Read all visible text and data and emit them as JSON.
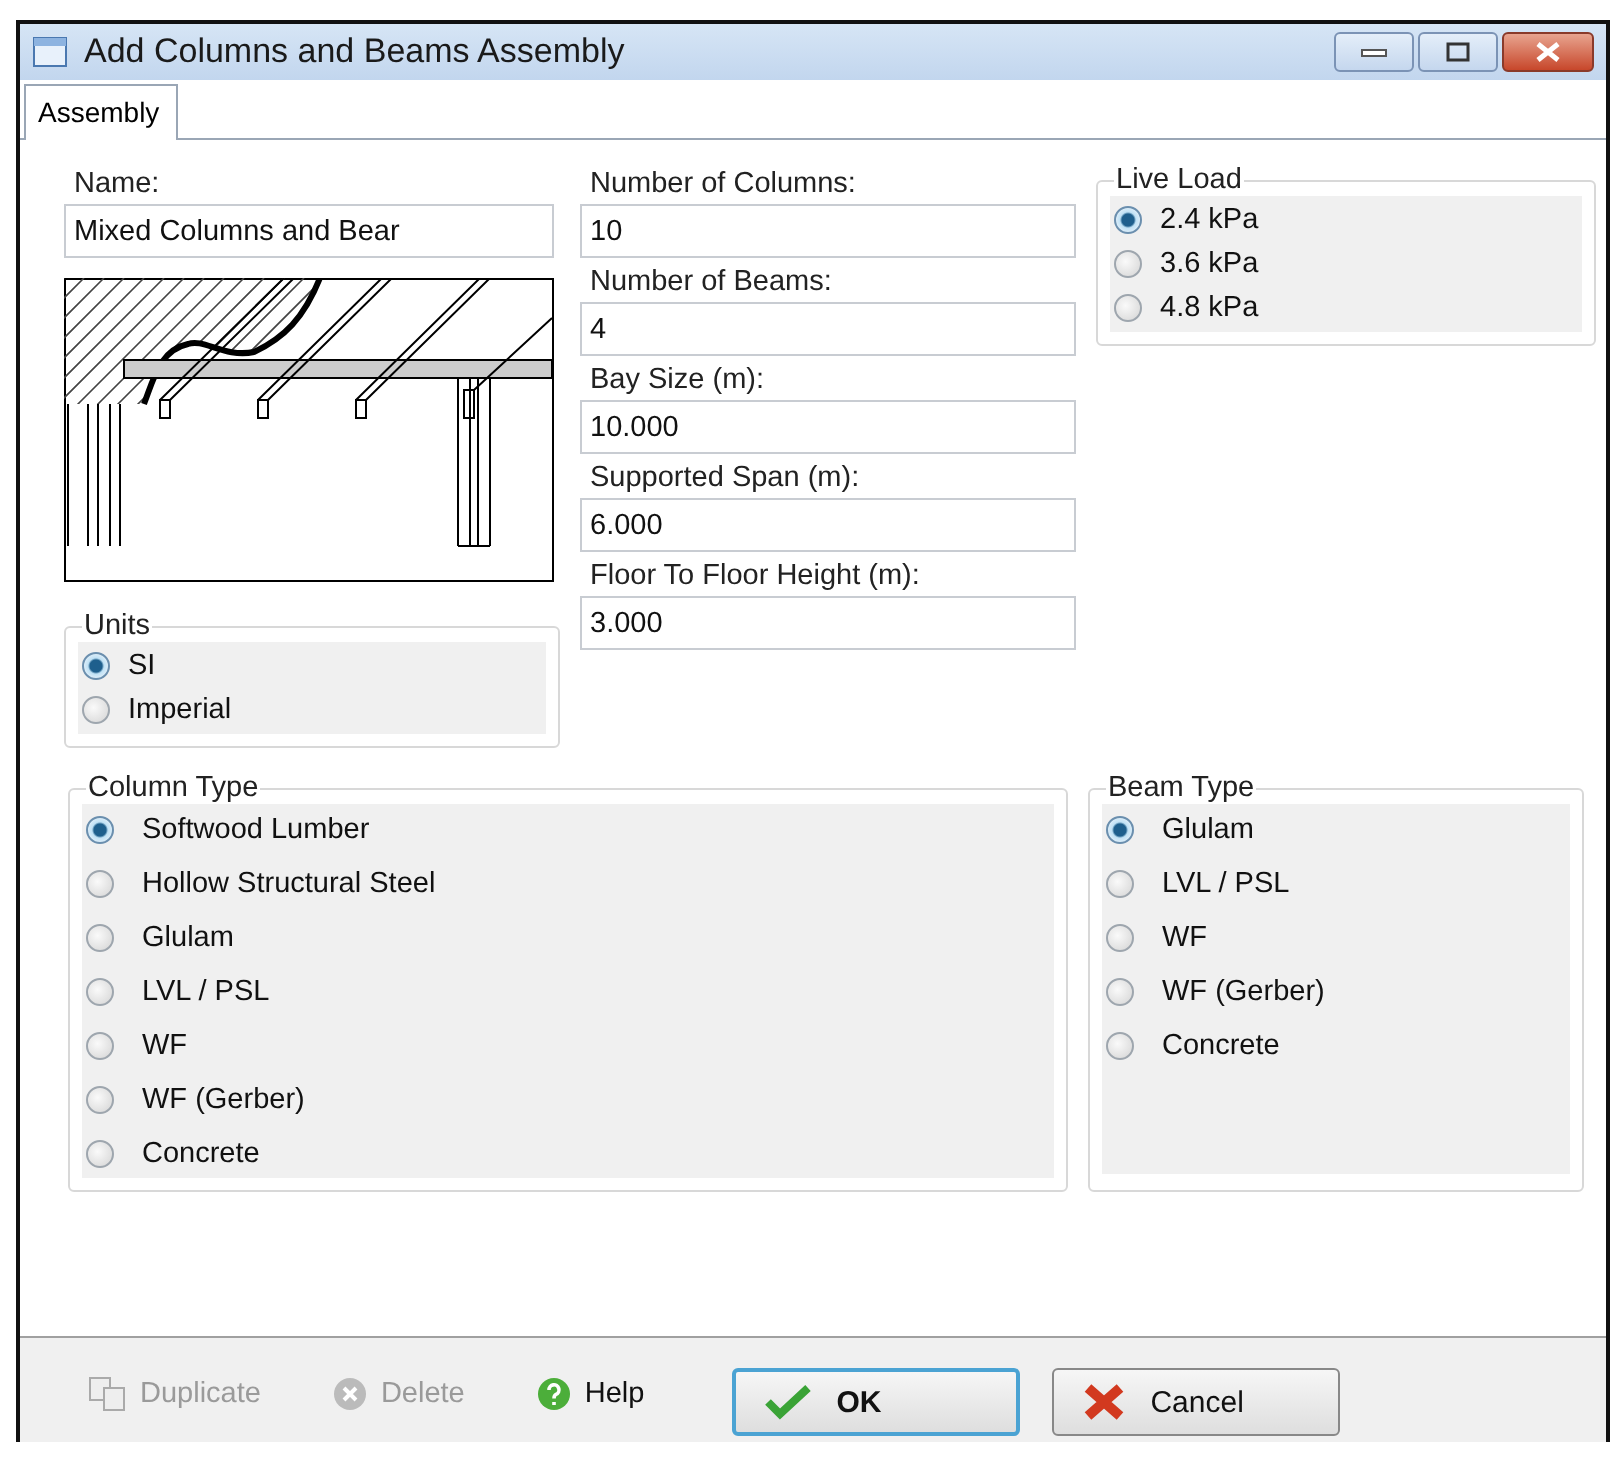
{
  "window": {
    "title": "Add  Columns and Beams Assembly"
  },
  "tabs": [
    {
      "label": "Assembly",
      "selected": true
    }
  ],
  "name": {
    "label": "Name:",
    "value": "Mixed Columns and Bear"
  },
  "units": {
    "title": "Units",
    "options": [
      {
        "label": "SI",
        "selected": true
      },
      {
        "label": "Imperial",
        "selected": false
      }
    ]
  },
  "fields": [
    {
      "label": "Number of Columns:",
      "value": "10"
    },
    {
      "label": "Number of Beams:",
      "value": "4"
    },
    {
      "label": "Bay Size (m):",
      "value": "10.000"
    },
    {
      "label": "Supported Span (m):",
      "value": "6.000"
    },
    {
      "label": "Floor To Floor Height (m):",
      "value": "3.000"
    }
  ],
  "live_load": {
    "title": "Live Load",
    "options": [
      {
        "label": "2.4 kPa",
        "selected": true
      },
      {
        "label": "3.6 kPa",
        "selected": false
      },
      {
        "label": "4.8 kPa",
        "selected": false
      }
    ]
  },
  "column_type": {
    "title": "Column Type",
    "options": [
      {
        "label": "Softwood Lumber",
        "selected": true
      },
      {
        "label": "Hollow Structural Steel",
        "selected": false
      },
      {
        "label": "Glulam",
        "selected": false
      },
      {
        "label": "LVL / PSL",
        "selected": false
      },
      {
        "label": "WF",
        "selected": false
      },
      {
        "label": "WF (Gerber)",
        "selected": false
      },
      {
        "label": "Concrete",
        "selected": false
      }
    ]
  },
  "beam_type": {
    "title": "Beam Type",
    "options": [
      {
        "label": "Glulam",
        "selected": true
      },
      {
        "label": "LVL / PSL",
        "selected": false
      },
      {
        "label": "WF",
        "selected": false
      },
      {
        "label": "WF (Gerber)",
        "selected": false
      },
      {
        "label": "Concrete",
        "selected": false
      }
    ]
  },
  "buttons": [
    {
      "kind": "duplicate",
      "label": "Duplicate",
      "disabled": true
    },
    {
      "kind": "delete",
      "label": "Delete",
      "disabled": true
    },
    {
      "kind": "help",
      "label": "Help",
      "disabled": false
    },
    {
      "kind": "ok",
      "label": "OK",
      "disabled": false
    },
    {
      "kind": "cancel",
      "label": "Cancel",
      "disabled": false
    }
  ]
}
